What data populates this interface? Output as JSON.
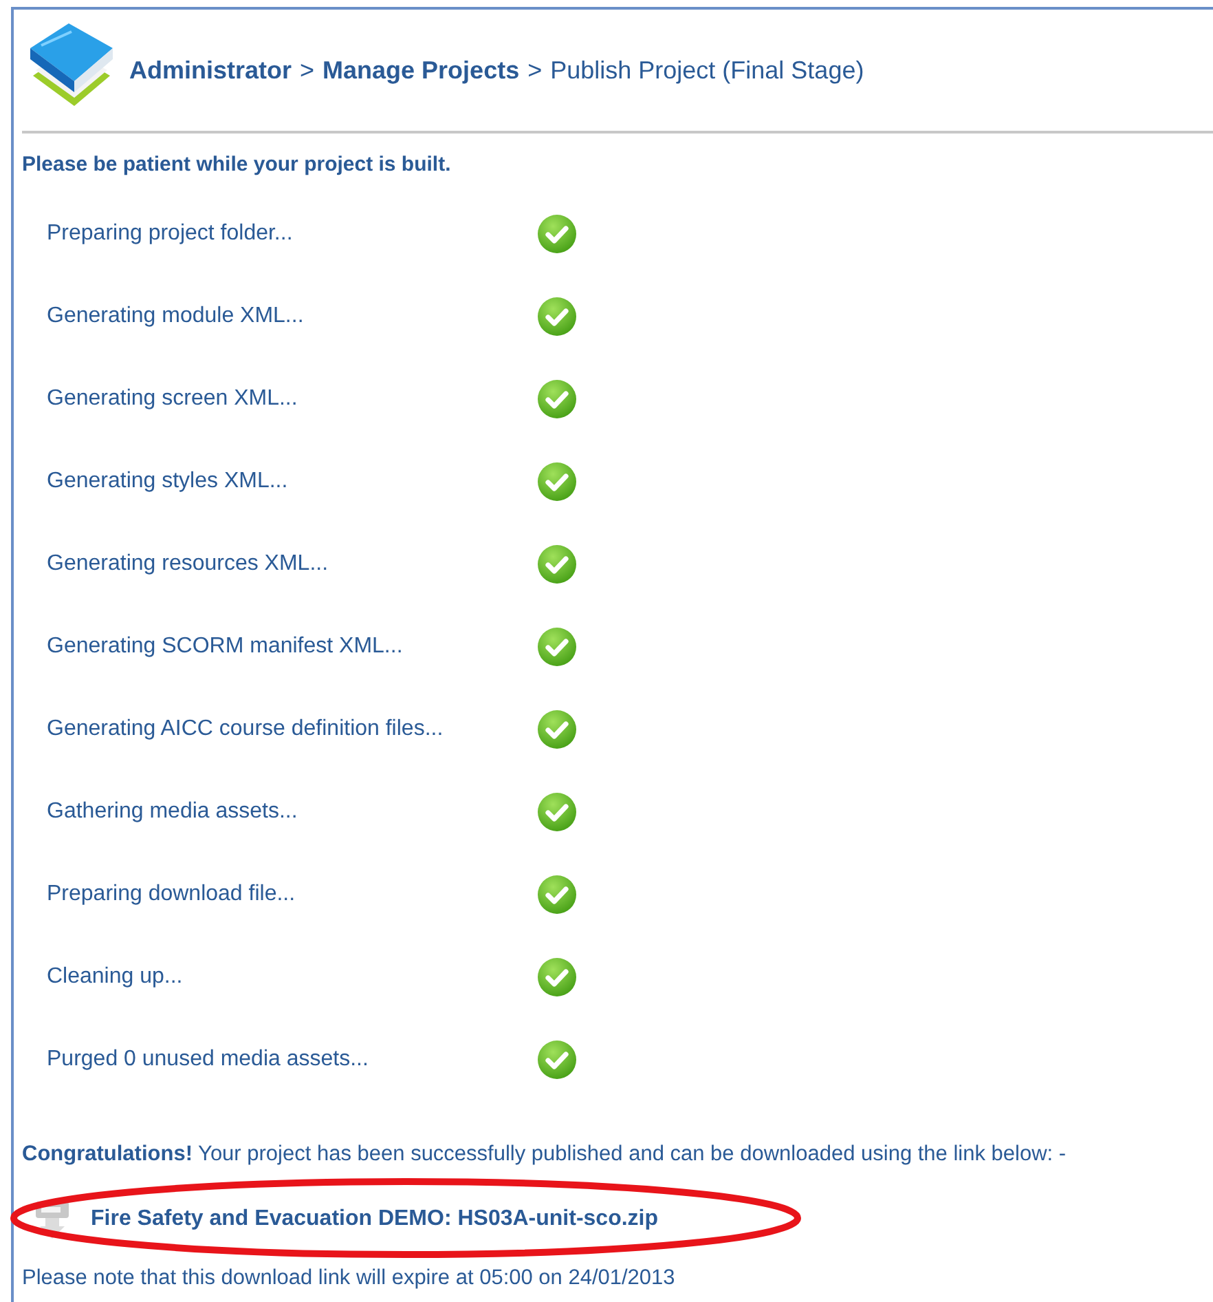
{
  "breadcrumb": [
    {
      "label": "Administrator",
      "current": false
    },
    {
      "label": "Manage Projects",
      "current": false
    },
    {
      "label": "Publish Project (Final Stage)",
      "current": true
    }
  ],
  "separator": ">",
  "intro": "Please be patient while your project is built.",
  "steps": [
    {
      "label": "Preparing project folder...",
      "done": true
    },
    {
      "label": "Generating module XML...",
      "done": true
    },
    {
      "label": "Generating screen XML...",
      "done": true
    },
    {
      "label": "Generating styles XML...",
      "done": true
    },
    {
      "label": "Generating resources XML...",
      "done": true
    },
    {
      "label": "Generating SCORM manifest XML...",
      "done": true
    },
    {
      "label": "Generating AICC course definition files...",
      "done": true
    },
    {
      "label": "Gathering media assets...",
      "done": true
    },
    {
      "label": "Preparing download file...",
      "done": true
    },
    {
      "label": "Cleaning up...",
      "done": true
    },
    {
      "label": "Purged 0 unused media assets...",
      "done": true
    }
  ],
  "message": "**Congratulations!** Your project has been successfully published and can be downloaded using the link below: -",
  "download_link": "Fire Safety and Evacuation DEMO: HS03A-unit-sco.zip",
  "expiry_note": "Please note that this download link will expire at 05:00 on 24/01/2013",
  "highlight_circle": true
}
